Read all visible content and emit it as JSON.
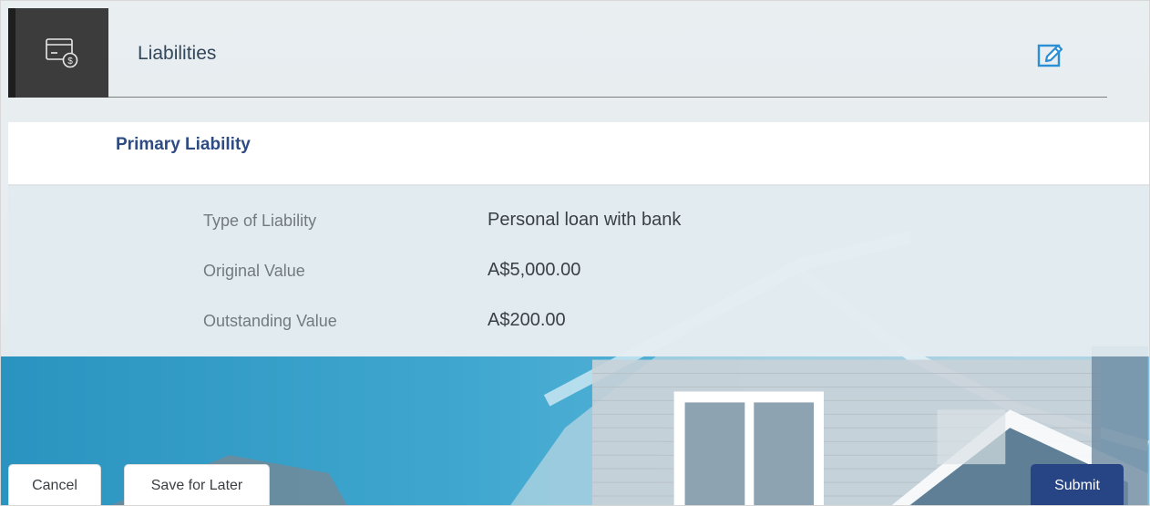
{
  "header": {
    "title": "Liabilities",
    "icon": "card-dollar-icon",
    "edit_icon": "edit-icon"
  },
  "section": {
    "title": "Primary Liability"
  },
  "details": [
    {
      "label": "Type of Liability",
      "value": "Personal loan with bank"
    },
    {
      "label": "Original Value",
      "value": "A$5,000.00"
    },
    {
      "label": "Outstanding Value",
      "value": "A$200.00"
    }
  ],
  "actions": {
    "cancel": "Cancel",
    "save_for_later": "Save for Later",
    "submit": "Submit"
  },
  "colors": {
    "primary": "#274585",
    "section_title": "#2e4c83",
    "header_icon_bg": "#3c3c3c",
    "edit_icon": "#2a8fd4"
  }
}
